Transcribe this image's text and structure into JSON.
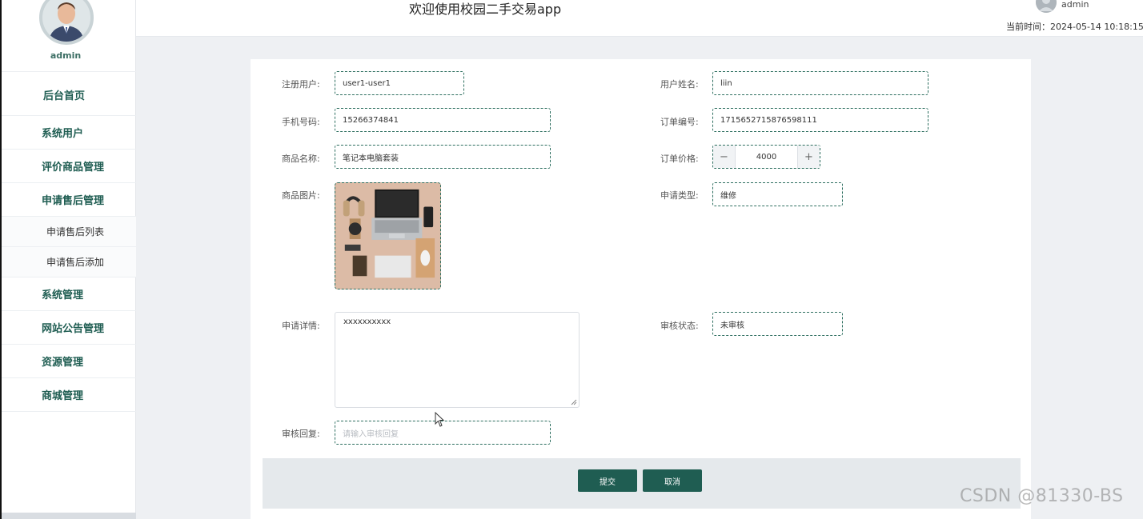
{
  "header": {
    "app_title": "欢迎使用校园二手交易app",
    "user_name": "admin",
    "time_label": "当前时间：2024-05-14 10:18:15"
  },
  "sidebar": {
    "admin_name": "admin",
    "items": [
      {
        "label": "后台首页"
      },
      {
        "label": "系统用户"
      },
      {
        "label": "评价商品管理"
      },
      {
        "label": "申请售后管理"
      },
      {
        "label": "申请售后列表"
      },
      {
        "label": "申请售后添加"
      },
      {
        "label": "系统管理"
      },
      {
        "label": "网站公告管理"
      },
      {
        "label": "资源管理"
      },
      {
        "label": "商城管理"
      }
    ]
  },
  "form": {
    "register_user": {
      "label": "注册用户:",
      "value": "user1-user1"
    },
    "user_name": {
      "label": "用户姓名:",
      "value": "liin"
    },
    "phone": {
      "label": "手机号码:",
      "value": "15266374841"
    },
    "order_no": {
      "label": "订单编号:",
      "value": "1715652715876598111"
    },
    "product_name": {
      "label": "商品名称:",
      "value": "笔记本电脑套装"
    },
    "order_price": {
      "label": "订单价格:",
      "value": "4000",
      "minus": "−",
      "plus": "+"
    },
    "product_image": {
      "label": "商品图片:"
    },
    "apply_type": {
      "label": "申请类型:",
      "value": "维修"
    },
    "apply_detail": {
      "label": "申请详情:",
      "value": "xxxxxxxxxx"
    },
    "review_status": {
      "label": "审核状态:",
      "value": "未审核"
    },
    "review_reply": {
      "label": "审核回复:",
      "placeholder": "请输入审核回复"
    },
    "submit": "提交",
    "cancel": "取消"
  },
  "watermark": "CSDN @81330-BS",
  "colors": {
    "accent": "#1f5d52",
    "field_border": "#2e6f60"
  }
}
